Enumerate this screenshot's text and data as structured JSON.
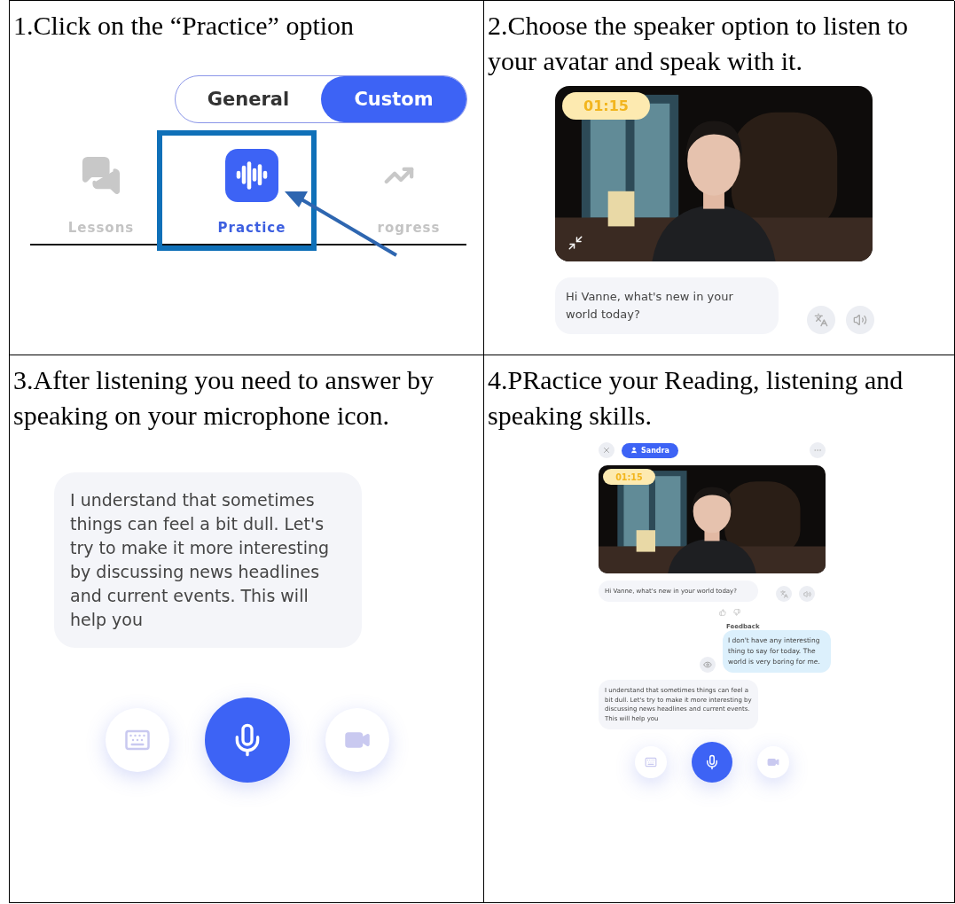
{
  "cells": [
    {
      "kind": "tabs",
      "caption": "1.Click on the “Practice” option",
      "segments": [
        {
          "label": "General",
          "selected": false
        },
        {
          "label": "Custom",
          "selected": true
        }
      ],
      "nav": [
        {
          "label": "Lessons",
          "selected": false
        },
        {
          "label": "Practice",
          "selected": true
        },
        {
          "label": "rogress",
          "selected": false
        }
      ]
    },
    {
      "kind": "video",
      "caption": "2.Choose the speaker option to listen to your avatar and speak with it.",
      "timer": "01:15",
      "message": "Hi Vanne, what's new in your world today?"
    },
    {
      "kind": "answer",
      "caption": "3.After listening you need to answer by speaking on your microphone icon.",
      "message": "I understand that sometimes things can feel a bit dull. Let's try to make it more interesting by discussing news headlines and current events. This will help you"
    },
    {
      "kind": "session",
      "caption": "4.PRactice your Reading, listening and speaking skills.",
      "user": "Sandra",
      "timer": "01:15",
      "message": "Hi Vanne, what's new in your world today?",
      "feedback_label": "Feedback",
      "user_message": "I don't have any interesting thing to say for today. The world is very boring for me.",
      "reply": "I understand that sometimes things can feel a bit dull. Let's try to make it more interesting by discussing news headlines and current events. This will help you"
    }
  ]
}
